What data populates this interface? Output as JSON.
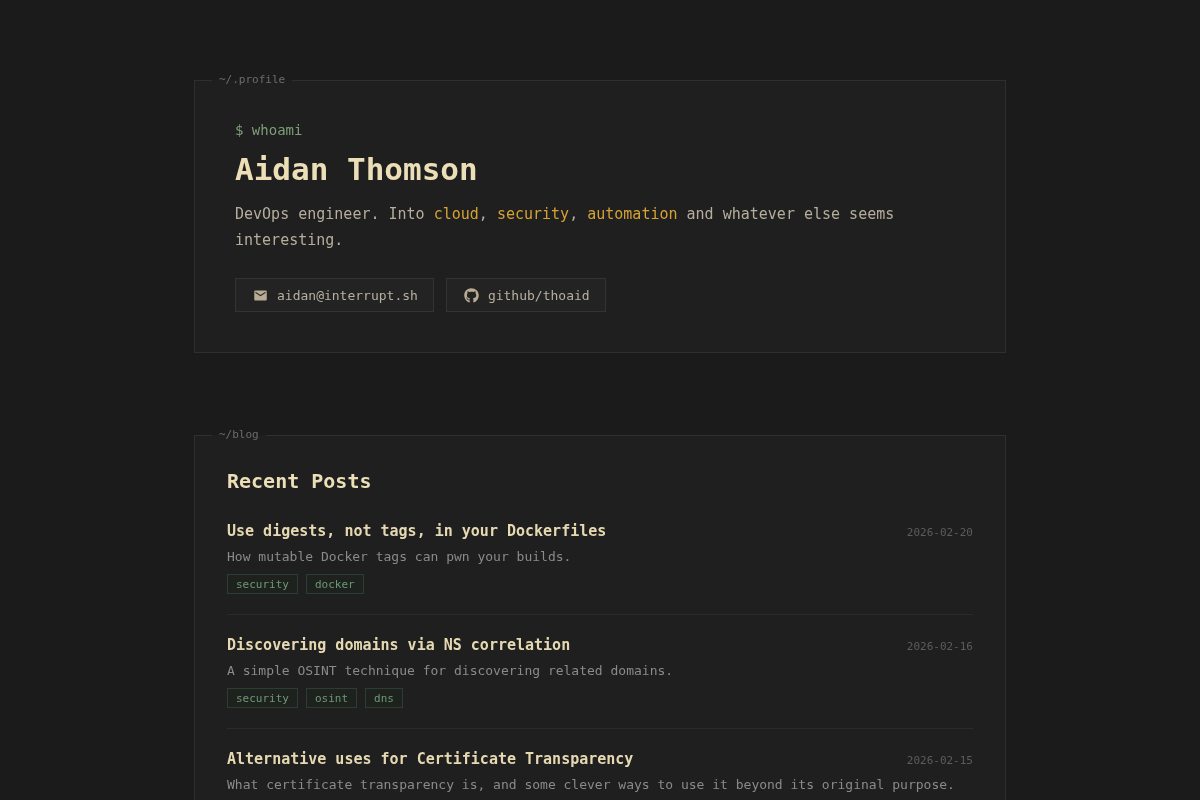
{
  "profile": {
    "label": "~/.profile",
    "prompt": "$ whoami",
    "name": "Aidan Thomson",
    "bio": [
      {
        "text": "DevOps engineer. Into ",
        "highlight": false
      },
      {
        "text": "cloud",
        "highlight": true
      },
      {
        "text": ", ",
        "highlight": false
      },
      {
        "text": "security",
        "highlight": true
      },
      {
        "text": ", ",
        "highlight": false
      },
      {
        "text": "automation",
        "highlight": true
      },
      {
        "text": " and whatever else seems interesting.",
        "highlight": false
      }
    ],
    "links": [
      {
        "kind": "email",
        "label": "aidan@interrupt.sh"
      },
      {
        "kind": "github",
        "label": "github/thoaid"
      }
    ]
  },
  "blog": {
    "label": "~/blog",
    "heading": "Recent Posts",
    "posts": [
      {
        "title": "Use digests, not tags, in your Dockerfiles",
        "date": "2026-02-20",
        "summary": "How mutable Docker tags can pwn your builds.",
        "tags": [
          "security",
          "docker"
        ]
      },
      {
        "title": "Discovering domains via NS correlation",
        "date": "2026-02-16",
        "summary": "A simple OSINT technique for discovering related domains.",
        "tags": [
          "security",
          "osint",
          "dns"
        ]
      },
      {
        "title": "Alternative uses for Certificate Transparency",
        "date": "2026-02-15",
        "summary": "What certificate transparency is, and some clever ways to use it beyond its original purpose."
      }
    ]
  }
}
